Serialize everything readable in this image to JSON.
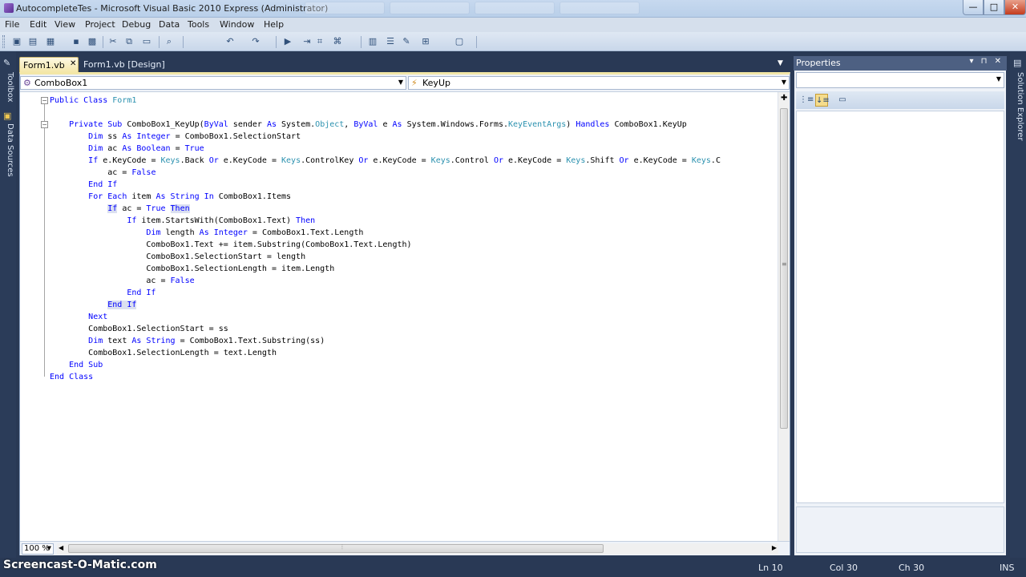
{
  "window": {
    "title": "AutocompleteTes - Microsoft Visual Basic 2010 Express (Administrator)",
    "min_glyph": "—",
    "max_glyph": "□",
    "close_glyph": "✕"
  },
  "menu": [
    "File",
    "Edit",
    "View",
    "Project",
    "Debug",
    "Data",
    "Tools",
    "Window",
    "Help"
  ],
  "toolbar_icons": [
    "new-project-icon",
    "open-file-icon",
    "add-item-icon",
    "save-icon",
    "save-all-icon",
    "cut-icon",
    "copy-icon",
    "paste-icon",
    "find-icon",
    "undo-icon",
    "redo-icon",
    "start-debug-icon",
    "step-icon",
    "comment-icon",
    "uncomment-icon",
    "solution-explorer-icon",
    "properties-icon",
    "toolbox-icon",
    "object-browser-icon",
    "output-icon"
  ],
  "side_tabs": {
    "toolbox": "Toolbox",
    "data_sources": "Data Sources",
    "solution_explorer": "Solution Explorer"
  },
  "doc_tabs": [
    {
      "label": "Form1.vb",
      "active": true,
      "close": "✕"
    },
    {
      "label": "Form1.vb [Design]",
      "active": false
    }
  ],
  "nav": {
    "object_combo": "ComboBox1",
    "event_combo": "KeyUp"
  },
  "code_lines": [
    [
      [
        "kw",
        "Public Class "
      ],
      [
        "ty",
        "Form1"
      ]
    ],
    [],
    [
      [
        "",
        "    "
      ],
      [
        "kw",
        "Private Sub "
      ],
      [
        "",
        "ComboBox1_KeyUp("
      ],
      [
        "kw",
        "ByVal "
      ],
      [
        "",
        "sender "
      ],
      [
        "kw",
        "As "
      ],
      [
        "",
        "System."
      ],
      [
        "ty",
        "Object"
      ],
      [
        "",
        ", "
      ],
      [
        "kw",
        "ByVal "
      ],
      [
        "",
        "e "
      ],
      [
        "kw",
        "As "
      ],
      [
        "",
        "System.Windows.Forms."
      ],
      [
        "ty",
        "KeyEventArgs"
      ],
      [
        "",
        ") "
      ],
      [
        "kw",
        "Handles "
      ],
      [
        "",
        "ComboBox1.KeyUp"
      ]
    ],
    [
      [
        "",
        "        "
      ],
      [
        "kw",
        "Dim "
      ],
      [
        "",
        "ss "
      ],
      [
        "kw",
        "As Integer "
      ],
      [
        "",
        "= ComboBox1.SelectionStart"
      ]
    ],
    [
      [
        "",
        "        "
      ],
      [
        "kw",
        "Dim "
      ],
      [
        "",
        "ac "
      ],
      [
        "kw",
        "As Boolean "
      ],
      [
        "",
        "= "
      ],
      [
        "kw",
        "True"
      ]
    ],
    [
      [
        "",
        "        "
      ],
      [
        "kw",
        "If "
      ],
      [
        "",
        "e.KeyCode = "
      ],
      [
        "ty",
        "Keys"
      ],
      [
        "",
        ".Back "
      ],
      [
        "kw",
        "Or "
      ],
      [
        "",
        "e.KeyCode = "
      ],
      [
        "ty",
        "Keys"
      ],
      [
        "",
        ".ControlKey "
      ],
      [
        "kw",
        "Or "
      ],
      [
        "",
        "e.KeyCode = "
      ],
      [
        "ty",
        "Keys"
      ],
      [
        "",
        ".Control "
      ],
      [
        "kw",
        "Or "
      ],
      [
        "",
        "e.KeyCode = "
      ],
      [
        "ty",
        "Keys"
      ],
      [
        "",
        ".Shift "
      ],
      [
        "kw",
        "Or "
      ],
      [
        "",
        "e.KeyCode = "
      ],
      [
        "ty",
        "Keys"
      ],
      [
        "",
        ".C"
      ]
    ],
    [
      [
        "",
        "            ac = "
      ],
      [
        "kw",
        "False"
      ]
    ],
    [
      [
        "",
        "        "
      ],
      [
        "kw",
        "End If"
      ]
    ],
    [
      [
        "",
        "        "
      ],
      [
        "kw",
        "For Each "
      ],
      [
        "",
        "item "
      ],
      [
        "kw",
        "As String In "
      ],
      [
        "",
        "ComboBox1.Items"
      ]
    ],
    [
      [
        "",
        "            "
      ],
      [
        "kwhl",
        "If"
      ],
      [
        "",
        " ac = "
      ],
      [
        "kw",
        "True "
      ],
      [
        "kwhl",
        "Then"
      ]
    ],
    [
      [
        "",
        "                "
      ],
      [
        "kw",
        "If "
      ],
      [
        "",
        "item.StartsWith(ComboBox1.Text) "
      ],
      [
        "kw",
        "Then"
      ]
    ],
    [
      [
        "",
        "                    "
      ],
      [
        "kw",
        "Dim "
      ],
      [
        "",
        "length "
      ],
      [
        "kw",
        "As Integer "
      ],
      [
        "",
        "= ComboBox1.Text.Length"
      ]
    ],
    [
      [
        "",
        "                    ComboBox1.Text += item.Substring(ComboBox1.Text.Length)"
      ]
    ],
    [
      [
        "",
        "                    ComboBox1.SelectionStart = length"
      ]
    ],
    [
      [
        "",
        "                    ComboBox1.SelectionLength = item.Length"
      ]
    ],
    [
      [
        "",
        "                    ac = "
      ],
      [
        "kw",
        "False"
      ]
    ],
    [
      [
        "",
        "                "
      ],
      [
        "kw",
        "End If"
      ]
    ],
    [
      [
        "",
        "            "
      ],
      [
        "kwhl",
        "End If"
      ]
    ],
    [
      [
        "",
        "        "
      ],
      [
        "kw",
        "Next"
      ]
    ],
    [
      [
        "",
        "        ComboBox1.SelectionStart = ss"
      ]
    ],
    [
      [
        "",
        "        "
      ],
      [
        "kw",
        "Dim "
      ],
      [
        "",
        "text "
      ],
      [
        "kw",
        "As String "
      ],
      [
        "",
        "= ComboBox1.Text.Substring(ss)"
      ]
    ],
    [
      [
        "",
        "        ComboBox1.SelectionLength = text.Length"
      ]
    ],
    [
      [
        "",
        "    "
      ],
      [
        "kw",
        "End Sub"
      ]
    ],
    [
      [
        "kw",
        "End Class"
      ]
    ]
  ],
  "zoom": "100 %",
  "properties": {
    "title": "Properties",
    "controls": "▾ ⊓ ✕"
  },
  "status": {
    "ln": "Ln 10",
    "col": "Col 30",
    "ch": "Ch 30",
    "mode": "INS"
  },
  "watermark": "Screencast-O-Matic.com",
  "colors": {
    "keyword": "#0000ff",
    "type": "#2b91af",
    "chrome_dark": "#293955",
    "active_tab": "#f4e7a8"
  }
}
